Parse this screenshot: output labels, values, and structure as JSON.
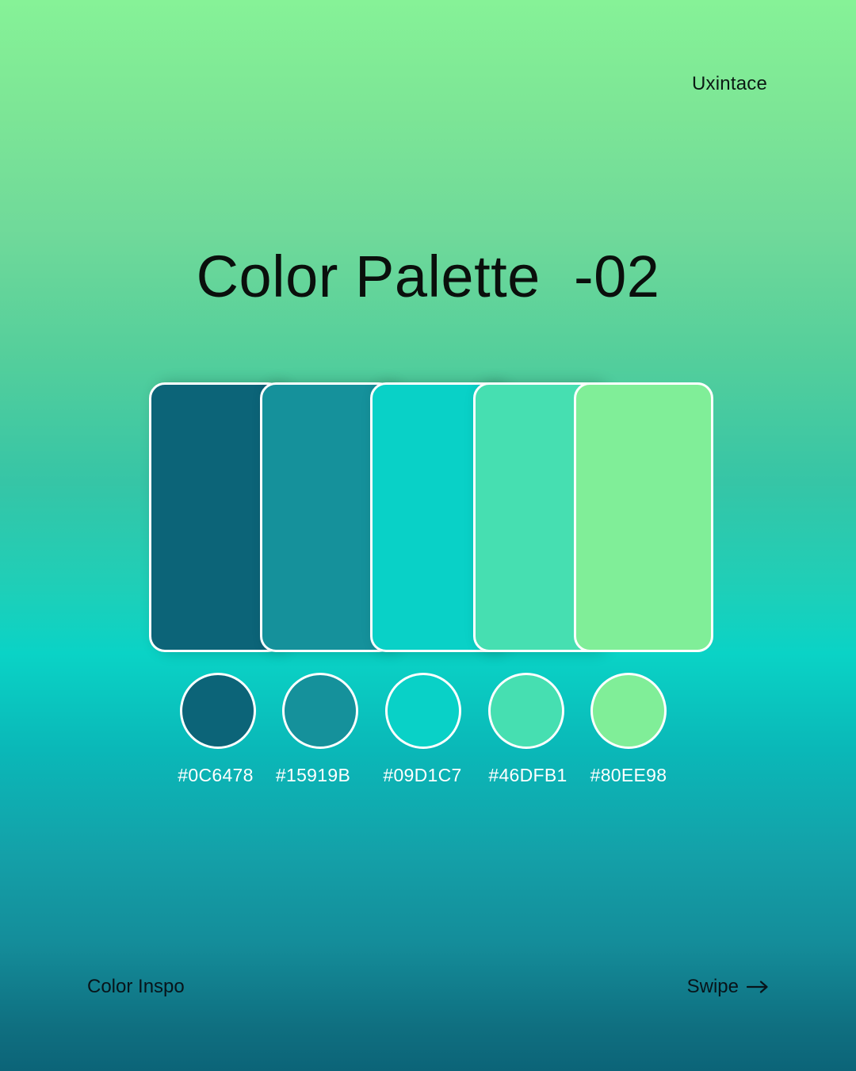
{
  "brand": "Uxintace",
  "title": "Color Palette  -02",
  "palette": [
    {
      "hex": "#0C6478",
      "label": "#0C6478"
    },
    {
      "hex": "#15919B",
      "label": "#15919B"
    },
    {
      "hex": "#09D1C7",
      "label": "#09D1C7"
    },
    {
      "hex": "#46DFB1",
      "label": "#46DFB1"
    },
    {
      "hex": "#80EE98",
      "label": "#80EE98"
    }
  ],
  "footer": {
    "left_label": "Color Inspo",
    "right_label": "Swipe",
    "right_icon": "arrow-right-icon"
  }
}
